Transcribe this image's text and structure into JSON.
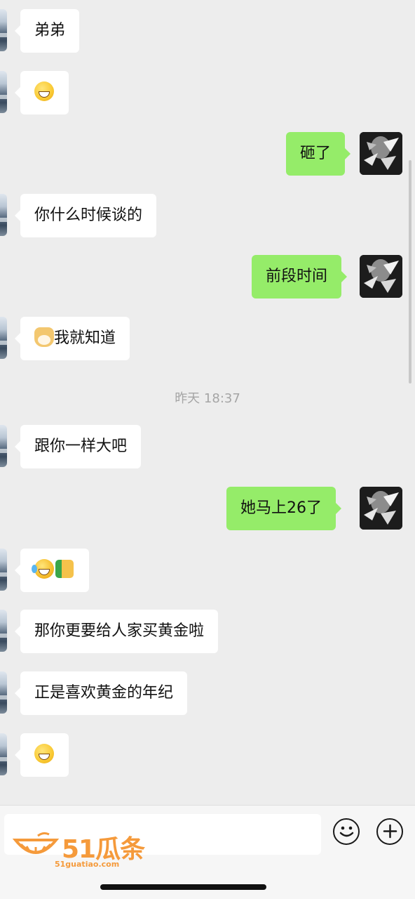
{
  "messages": [
    {
      "side": "in",
      "text": "弟弟"
    },
    {
      "side": "in",
      "emoji": "grin-emoji"
    },
    {
      "side": "out",
      "text": "砸了"
    },
    {
      "side": "in",
      "text": "你什么时候谈的"
    },
    {
      "side": "out",
      "text": "前段时间"
    },
    {
      "side": "in",
      "emoji": "doge-emoji",
      "text": "我就知道"
    },
    {
      "side": "in",
      "text": "跟你一样大吧"
    },
    {
      "side": "out",
      "text": "她马上26了"
    },
    {
      "side": "in",
      "emoji": "laugh-cry-emoji, thumbs-up-emoji"
    },
    {
      "side": "in",
      "text": "那你更要给人家买黄金啦"
    },
    {
      "side": "in",
      "text": "正是喜欢黄金的年纪"
    },
    {
      "side": "in",
      "emoji": "grin-emoji"
    }
  ],
  "timestamp": "昨天 18:37",
  "input_bar": {
    "text_value": "",
    "emoji_button_icon": "smiley-face-icon",
    "more_button_icon": "plus-circle-icon"
  },
  "watermark": {
    "brand": "51瓜条",
    "url": "51guatiao.com"
  },
  "colors": {
    "background": "#ededed",
    "incoming_bubble": "#ffffff",
    "outgoing_bubble": "#95ec69",
    "watermark": "#f59a3b"
  }
}
